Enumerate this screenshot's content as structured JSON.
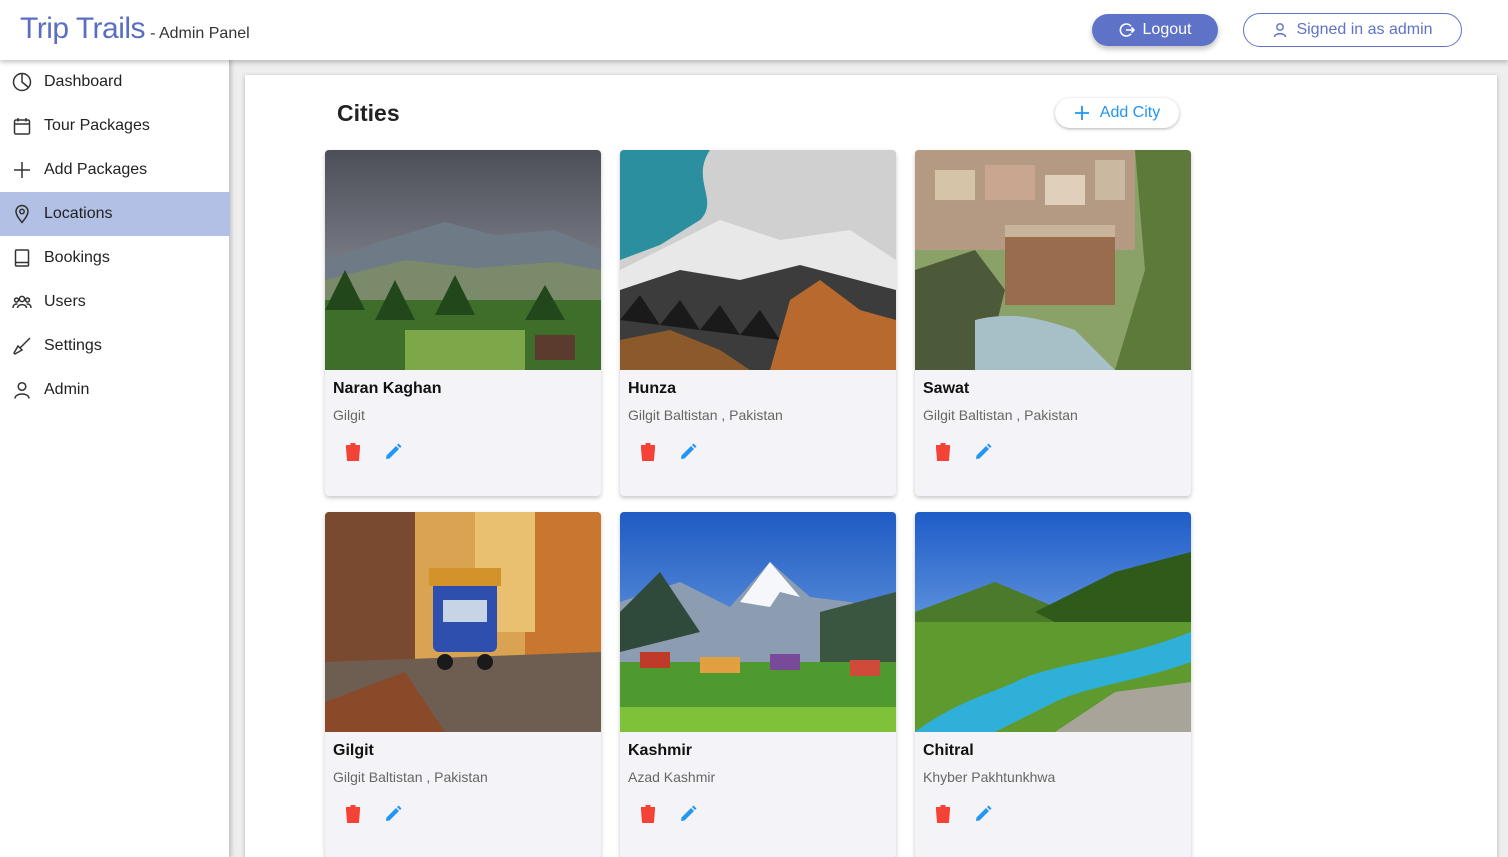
{
  "header": {
    "title": "Trip Trails",
    "subtitle": "- Admin Panel",
    "logout_label": "Logout",
    "signed_in_label": "Signed in as admin"
  },
  "sidebar": {
    "items": [
      {
        "label": "Dashboard",
        "icon": "chart-pie-icon"
      },
      {
        "label": "Tour Packages",
        "icon": "calendar-icon"
      },
      {
        "label": "Add Packages",
        "icon": "plus-icon"
      },
      {
        "label": "Locations",
        "icon": "map-pin-icon",
        "active": true
      },
      {
        "label": "Bookings",
        "icon": "book-icon"
      },
      {
        "label": "Users",
        "icon": "users-icon"
      },
      {
        "label": "Settings",
        "icon": "brush-icon"
      },
      {
        "label": "Admin",
        "icon": "user-icon"
      }
    ]
  },
  "main": {
    "title": "Cities",
    "add_label": "Add City",
    "cities": [
      {
        "name": "Naran Kaghan",
        "region": "Gilgit"
      },
      {
        "name": "Hunza",
        "region": "Gilgit Baltistan , Pakistan"
      },
      {
        "name": "Sawat",
        "region": "Gilgit Baltistan , Pakistan"
      },
      {
        "name": "Gilgit",
        "region": "Gilgit Baltistan , Pakistan"
      },
      {
        "name": "Kashmir",
        "region": "Azad Kashmir"
      },
      {
        "name": "Chitral",
        "region": "Khyber Pakhtunkhwa"
      }
    ]
  },
  "colors": {
    "brand": "#5a6fc4",
    "active_nav": "#b3c0e6",
    "delete": "#f44336",
    "edit": "#2196f3"
  }
}
